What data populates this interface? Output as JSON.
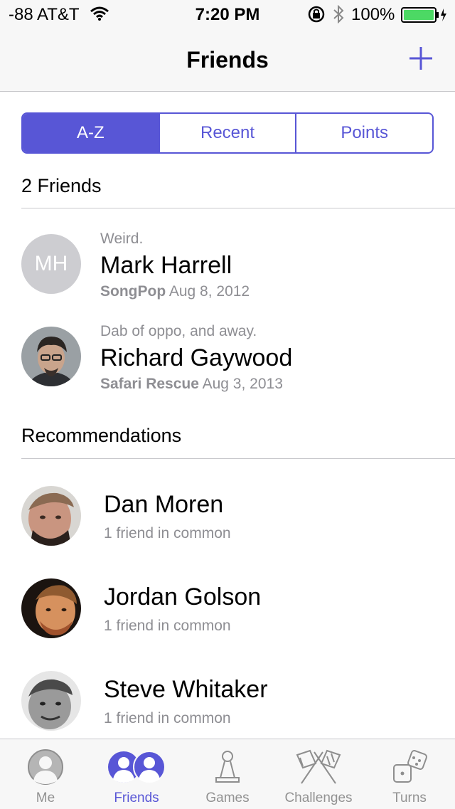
{
  "status_bar": {
    "carrier": "-88 AT&T",
    "time": "7:20 PM",
    "battery_percent": "100%",
    "icons": [
      "wifi-icon",
      "rotation-lock-icon",
      "bluetooth-icon",
      "battery-icon"
    ]
  },
  "nav": {
    "title": "Friends",
    "add_icon": "plus-icon"
  },
  "segments": {
    "items": [
      "A-Z",
      "Recent",
      "Points"
    ],
    "selected": "A-Z"
  },
  "friends_section": {
    "header": "2 Friends",
    "items": [
      {
        "note": "Weird.",
        "name": "Mark Harrell",
        "game": "SongPop",
        "date": "Aug 8, 2012",
        "initials": "MH"
      },
      {
        "note": "Dab of oppo, and away.",
        "name": "Richard Gaywood",
        "game": "Safari Rescue",
        "date": "Aug 3, 2013",
        "initials": ""
      }
    ]
  },
  "recommendations": {
    "header": "Recommendations",
    "items": [
      {
        "name": "Dan Moren",
        "subtitle": "1 friend in common"
      },
      {
        "name": "Jordan Golson",
        "subtitle": "1 friend in common"
      },
      {
        "name": "Steve Whitaker",
        "subtitle": "1 friend in common"
      }
    ]
  },
  "tabbar": {
    "items": [
      {
        "label": "Me",
        "icon": "person-icon"
      },
      {
        "label": "Friends",
        "icon": "friends-icon"
      },
      {
        "label": "Games",
        "icon": "pawn-icon"
      },
      {
        "label": "Challenges",
        "icon": "crossed-flags-icon"
      },
      {
        "label": "Turns",
        "icon": "dice-icon"
      }
    ],
    "selected": "Friends"
  },
  "colors": {
    "accent": "#5856d6",
    "secondary_text": "#8e8e93",
    "battery_green": "#4cd964",
    "bar_background": "#f7f7f7"
  }
}
